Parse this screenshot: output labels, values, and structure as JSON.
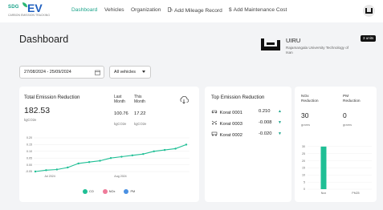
{
  "nav": {
    "logo_sdg": "SDG",
    "logo_ev": "EV",
    "logo_tagline": "CARBON EMISSION TRACKING",
    "items": [
      {
        "label": "Dashboard",
        "active": true
      },
      {
        "label": "Vehicles",
        "active": false
      },
      {
        "label": "Organization",
        "active": false
      },
      {
        "label": "Add Mileage Record",
        "icon": "fuel-icon",
        "active": false
      },
      {
        "label": "Add Maintenance Cost",
        "icon": "dollar-icon",
        "active": false
      }
    ]
  },
  "page": {
    "title": "Dashboard",
    "org_name": "UIRU",
    "org_sub": "Rajamangala University Technology of Isan",
    "badge": "3 units"
  },
  "filters": {
    "date_range": "27/08/2024 - 25/09/2024",
    "vehicle_select": "All vehicles"
  },
  "total_emission": {
    "title": "Total Emission Reduction",
    "value": "182.53",
    "unit": "kgCO2e",
    "last_month_label": "Last Month",
    "this_month_label": "This Month",
    "last_month_value": "100.76",
    "this_month_value": "17.22",
    "last_unit": "kgCO2e",
    "this_unit": "kgCO2e"
  },
  "top_emission": {
    "title": "Top Emission Reduction",
    "rows": [
      {
        "icon": "car-icon",
        "name": "Korat 0001",
        "value": "0.210"
      },
      {
        "icon": "scooter-icon",
        "name": "Korat 0003",
        "value": "-0.008"
      },
      {
        "icon": "tuktuk-icon",
        "name": "Korat 0002",
        "value": "-0.020"
      }
    ]
  },
  "stats": {
    "nox_label": "NOx Reduction",
    "nox_value": "30",
    "nox_unit": "grams",
    "pm_label": "PM Reduction",
    "pm_value": "0",
    "pm_unit": "grams"
  },
  "chart_data": [
    {
      "type": "line",
      "x": [
        "Jul 2024",
        "Aug 2024"
      ],
      "xlabel": "",
      "ylabel": "",
      "ylim": [
        -0.05,
        0.2
      ],
      "y_ticks": [
        "0.20",
        "0.15",
        "0.10",
        "0.05",
        "0.00",
        "-0.05"
      ],
      "x_ticks": [
        "Jul 2024",
        "Aug 2024"
      ],
      "series": [
        {
          "name": "CO",
          "color": "#1fbf95",
          "values": [
            -0.05,
            -0.04,
            -0.035,
            -0.02,
            0.01,
            0.02,
            0.03,
            0.05,
            0.06,
            0.07,
            0.08,
            0.1,
            0.11,
            0.12,
            0.15
          ]
        }
      ],
      "legend": [
        {
          "name": "CO",
          "color": "#1fbf95"
        },
        {
          "name": "NOx",
          "color": "#ef7b9a"
        },
        {
          "name": "PM",
          "color": "#4a90e2"
        }
      ],
      "legend_position": "bottom"
    },
    {
      "type": "bar",
      "categories": [
        "Nox",
        "PM25"
      ],
      "values": [
        30,
        0
      ],
      "ylim": [
        0,
        35
      ],
      "y_ticks": [
        "30",
        "25",
        "20",
        "15",
        "10",
        "5",
        "0"
      ],
      "color": "#1fbf95"
    }
  ]
}
